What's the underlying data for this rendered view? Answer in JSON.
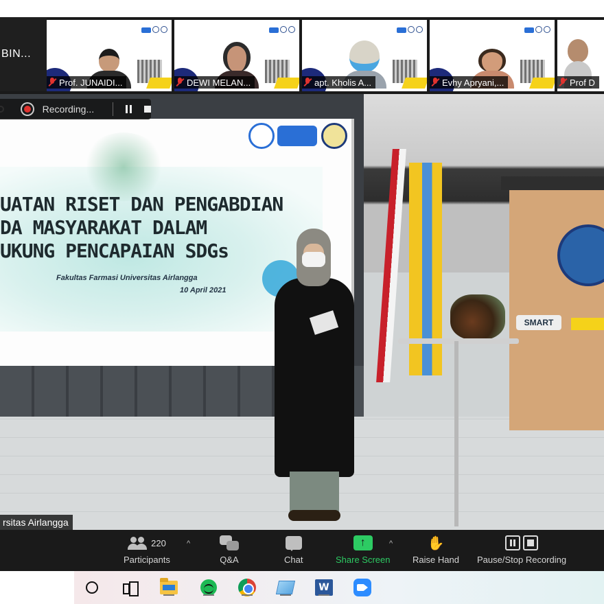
{
  "gallery": {
    "host_label": "BIN...",
    "tiles": [
      {
        "name": "Prof. JUNAIDI...",
        "muted": true
      },
      {
        "name": "DEWI MELAN...",
        "muted": true
      },
      {
        "name": "apt. Kholis A...",
        "muted": true
      },
      {
        "name": "Evhy Apryani,...",
        "muted": true
      },
      {
        "name": "Prof D",
        "muted": true
      }
    ]
  },
  "recording": {
    "label": "Recording..."
  },
  "slide": {
    "title_line1": "UATAN RISET DAN PENGABDIAN",
    "title_line2": "DA MASYARAKAT DALAM",
    "title_line3": "UKUNG PENCAPAIAN SDGs",
    "subtitle": "Fakultas Farmasi Universitas Airlangga",
    "date": "10 April 2021"
  },
  "booth": {
    "sponsor_text": "SMART"
  },
  "main_video": {
    "speaker_name": "rsitas Airlangga"
  },
  "controls": {
    "participants_count": "220",
    "participants_label": "Participants",
    "qa_label": "Q&A",
    "chat_label": "Chat",
    "share_label": "Share Screen",
    "raise_hand_label": "Raise Hand",
    "pause_stop_label": "Pause/Stop Recording",
    "share_color": "#2dcb63",
    "hand_color": "#f5b324"
  },
  "taskbar": {
    "word_letter": "W",
    "apps": [
      "cortana-icon",
      "task-view-icon",
      "file-explorer-icon",
      "spotify-icon",
      "chrome-icon",
      "sticky-notes-icon",
      "word-icon",
      "zoom-icon"
    ]
  }
}
